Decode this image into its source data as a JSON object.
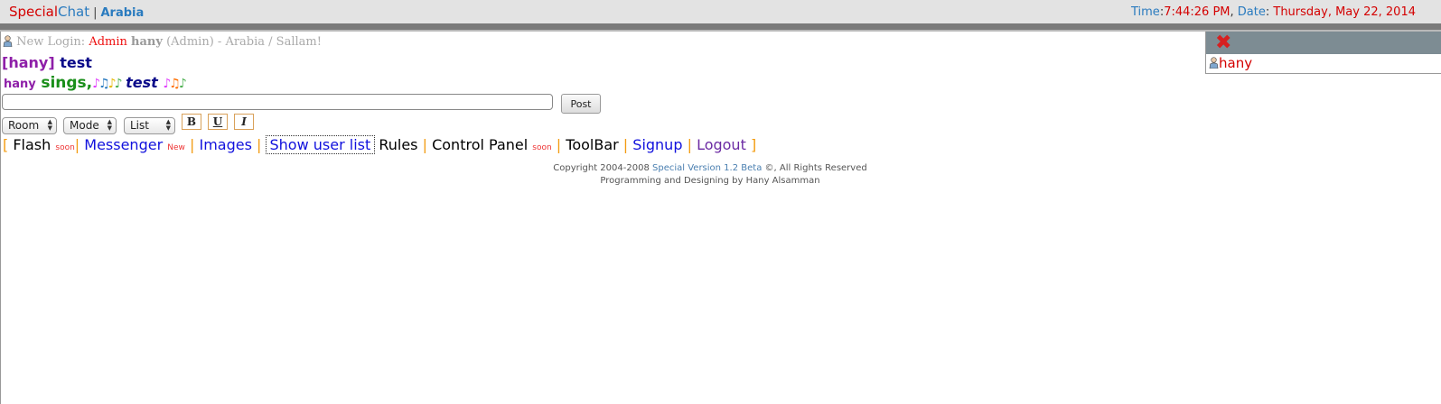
{
  "header": {
    "brand_special": "Special",
    "brand_chat": "Chat",
    "separator": "|",
    "room_name": "Arabia",
    "time_label": "Time",
    "time_value": "7:44:26 PM",
    "date_label": "Date",
    "date_value": "Thursday, May 22, 2014"
  },
  "messages": {
    "login": {
      "prefix": "New Login:",
      "role": "Admin",
      "name": "hany",
      "role_paren": "(Admin)",
      "suffix": "- Arabia / Sallam!"
    },
    "chat": {
      "nick": "[hany]",
      "text": "test"
    },
    "action": {
      "nick": "hany",
      "verb": "sings,",
      "text": "test"
    }
  },
  "composer": {
    "input_value": "",
    "post_label": "Post"
  },
  "toolbar": {
    "room_select": "Room",
    "mode_select": "Mode",
    "list_select": "List",
    "bold_label": "B",
    "underline_label": "U",
    "italic_label": "I"
  },
  "links": {
    "flash": "Flash",
    "flash_badge": "soon",
    "messenger": "Messenger",
    "messenger_badge": "New",
    "images": "Images",
    "show_user_list": "Show user list",
    "rules": "Rules",
    "control_panel": "Control Panel",
    "control_panel_badge": "soon",
    "toolbar": "ToolBar",
    "signup": "Signup",
    "logout": "Logout"
  },
  "footer": {
    "copyright_prefix": "Copyright 2004-2008",
    "product": "Special Version 1.2 Beta",
    "copyright_suffix": "©, All Rights Reserved",
    "credit": "Programming and Designing by Hany Alsamman"
  },
  "userlist": {
    "users": [
      "hany"
    ]
  },
  "colors": {
    "brand_red": "#d40000",
    "brand_blue": "#2a7bbf",
    "panel_header": "#7d8c93"
  }
}
